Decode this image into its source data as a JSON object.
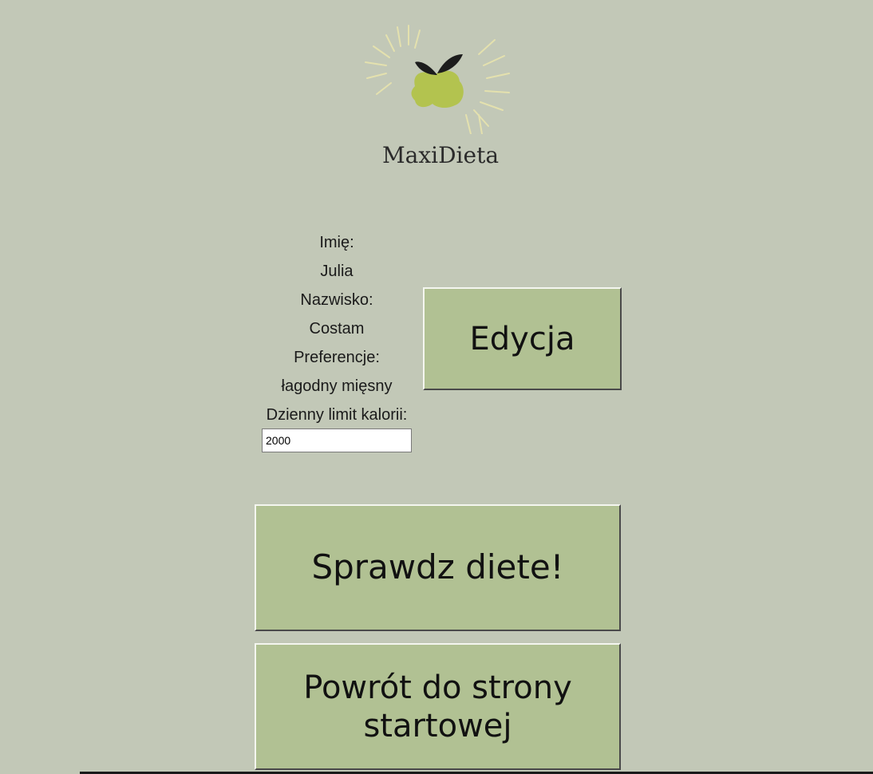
{
  "brand": {
    "name": "MaxiDieta",
    "icon": "lemon-leaf-logo"
  },
  "profile": {
    "first_name_label": "Imię:",
    "first_name": "Julia",
    "last_name_label": "Nazwisko:",
    "last_name": "Costam",
    "preferences_label": "Preferencje:",
    "preferences": "łagodny mięsny",
    "calorie_limit_label": "Dzienny limit kalorii:",
    "calorie_limit": "2000"
  },
  "buttons": {
    "edit": "Edycja",
    "check_diet": "Sprawdz diete!",
    "back": "Powrót do strony startowej"
  },
  "colors": {
    "background": "#c2c8b7",
    "button": "#b1c193",
    "logo_fruit": "#b3c34f",
    "logo_rays": "#e6e3b0"
  }
}
